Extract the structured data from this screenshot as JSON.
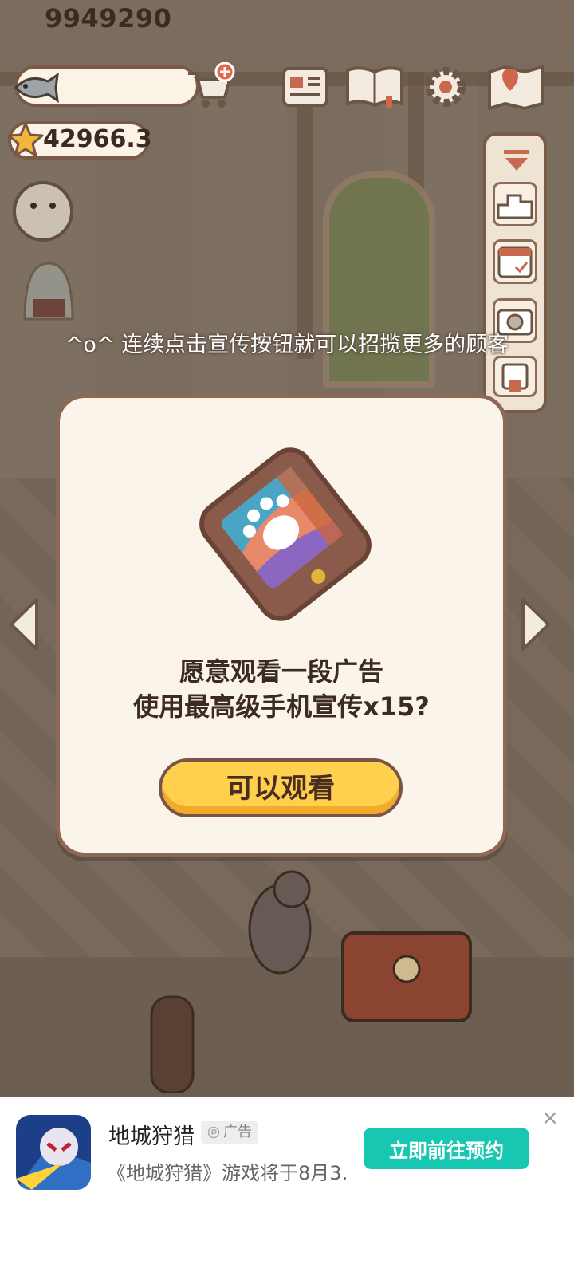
{
  "hud": {
    "fish_coins": "9949290",
    "stars": "42966.3",
    "icons": [
      "fish-icon",
      "cart-add-icon",
      "star-icon",
      "notice-board-icon",
      "recipe-book-icon",
      "settings-gear-icon",
      "map-icon"
    ]
  },
  "side_panel": {
    "icons": [
      "collapse-arrow-icon",
      "ranking-podium-icon",
      "calendar-check-icon",
      "camera-icon",
      "decor-icon"
    ]
  },
  "hint_text": "^o^ 连续点击宣传按钮就可以招揽更多的顾客",
  "dialog": {
    "line1": "愿意观看一段广告",
    "line2": "使用最高级手机宣传x15?",
    "button": "可以观看",
    "illustration": "paw-phone-icon"
  },
  "ad": {
    "title": "地城狩猎",
    "badge": "广告",
    "description": "《地城狩猎》游戏将于8月3…",
    "cta": "立即前往预约",
    "close": "×"
  },
  "colors": {
    "button_yellow": "#ffd04d",
    "dialog_bg": "#fbf4ea",
    "cta_teal": "#18c7b2"
  }
}
